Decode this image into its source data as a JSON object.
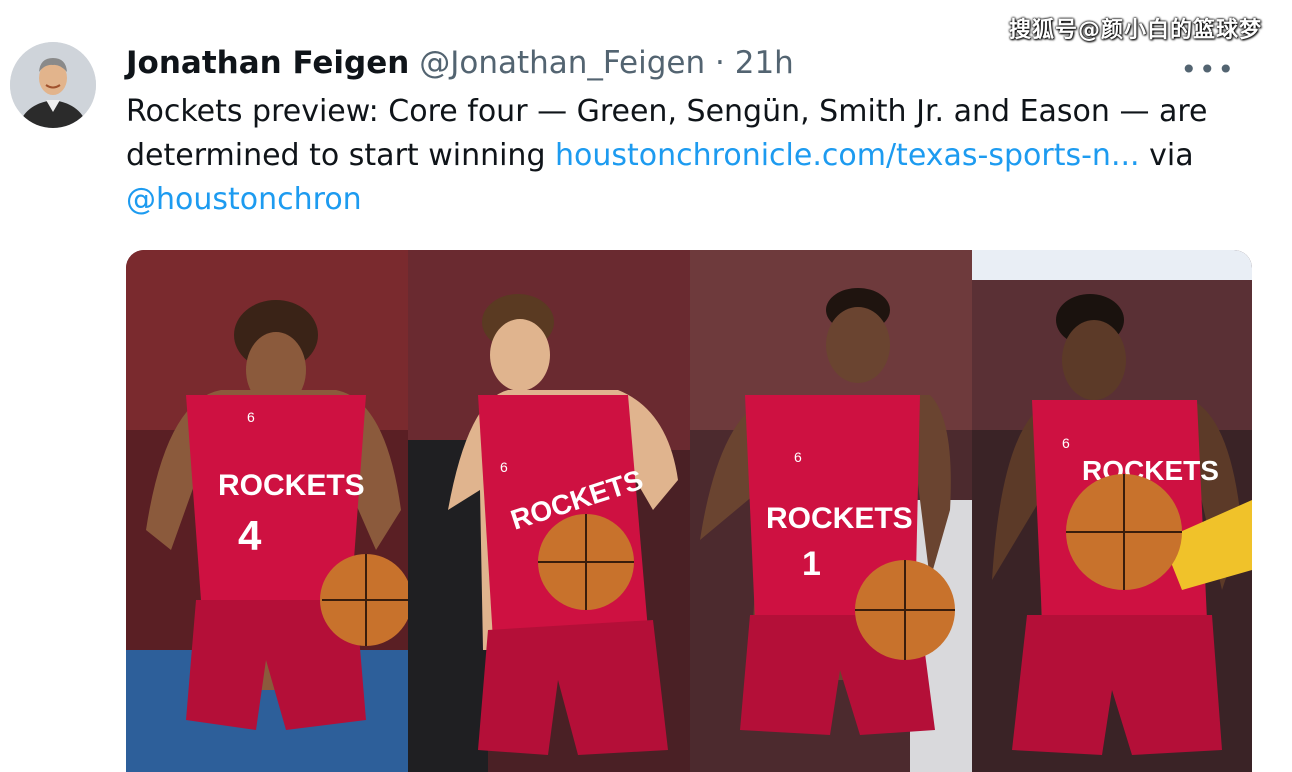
{
  "watermark": "搜狐号@颜小白的篮球梦",
  "tweet": {
    "author_name": "Jonathan Feigen",
    "handle": "@Jonathan_Feigen",
    "separator": "·",
    "time": "21h",
    "more_icon": "more-horizontal-icon",
    "text_part1": "Rockets preview: Core four — Green, Sengün, Smith Jr. and Eason — are determined to start winning ",
    "link_text": "houstonchronicle.com/texas-sports-n...",
    "text_part2": " via ",
    "mention": "@houstonchron"
  },
  "photos": [
    {
      "jersey_text": "ROCKETS",
      "number": "4",
      "patch": "6"
    },
    {
      "jersey_text": "ROCKETS",
      "number": "",
      "patch": "6"
    },
    {
      "jersey_text": "ROCKETS",
      "number": "1",
      "patch": "6"
    },
    {
      "jersey_text": "ROCKETS",
      "number": "",
      "patch": "6"
    }
  ],
  "colors": {
    "link": "#1d9bf0",
    "secondary_text": "#536471",
    "jersey_red": "#ce1141"
  }
}
